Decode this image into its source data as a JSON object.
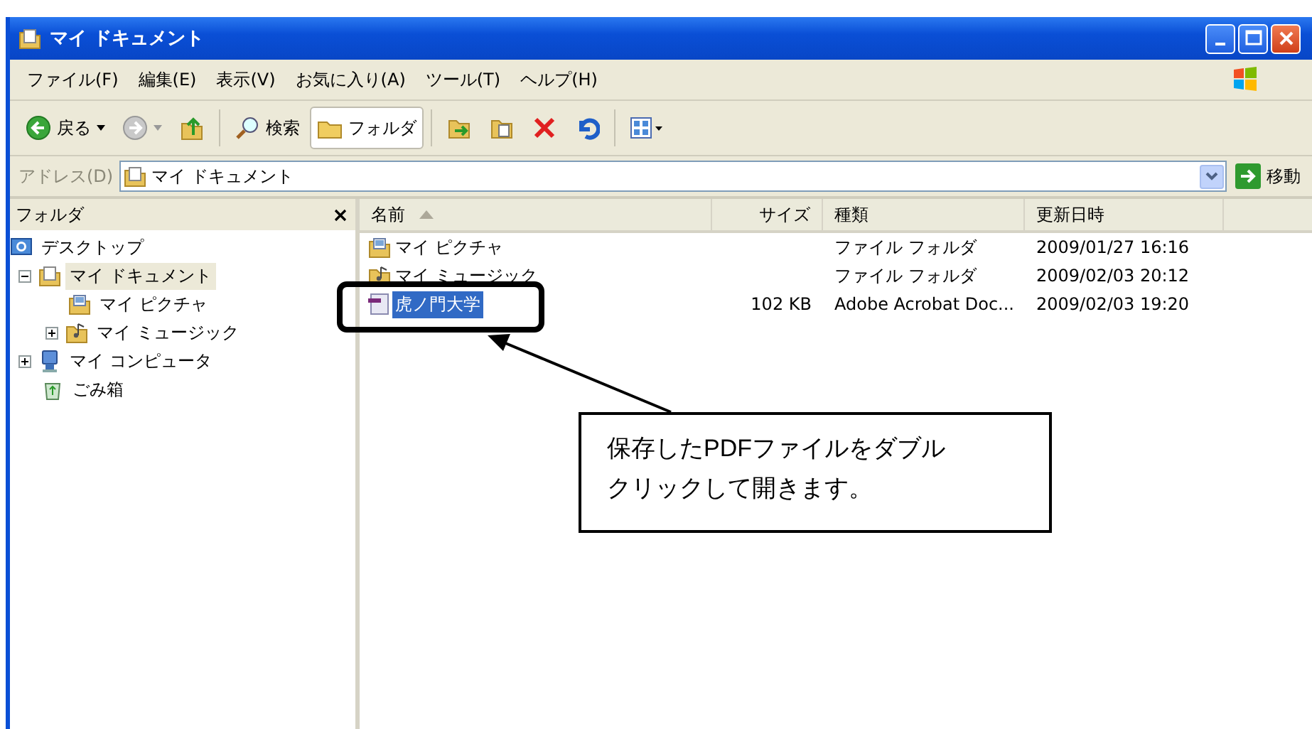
{
  "window": {
    "title": "マイ ドキュメント"
  },
  "menu": [
    "ファイル(F)",
    "編集(E)",
    "表示(V)",
    "お気に入り(A)",
    "ツール(T)",
    "ヘルプ(H)"
  ],
  "toolbar": [
    {
      "kind": "back",
      "label": "戻る",
      "selected": false
    },
    {
      "kind": "forward",
      "selected": false
    },
    {
      "kind": "up",
      "selected": false
    },
    {
      "kind": "search",
      "label": "検索",
      "selected": false
    },
    {
      "kind": "folders",
      "label": "フォルダ",
      "selected": true
    },
    {
      "kind": "move",
      "selected": false
    },
    {
      "kind": "copy",
      "selected": false
    },
    {
      "kind": "delete",
      "selected": false
    },
    {
      "kind": "undo",
      "selected": false
    },
    {
      "kind": "views",
      "selected": false
    }
  ],
  "address": {
    "label": "アドレス(D)",
    "value": "マイ ドキュメント",
    "go": "移動"
  },
  "folder_pane": {
    "title": "フォルダ",
    "tree": [
      {
        "label": "デスクトップ",
        "kind": "desktop",
        "selected": false,
        "children": [
          {
            "label": "マイ ドキュメント",
            "kind": "documents",
            "expanded": true,
            "selected": true,
            "children": [
              {
                "label": "マイ ピクチャ",
                "kind": "pictures",
                "selected": false
              },
              {
                "label": "マイ ミュージック",
                "kind": "music",
                "expanded": false,
                "selected": false
              }
            ]
          },
          {
            "label": "マイ コンピュータ",
            "kind": "computer",
            "expanded": false,
            "selected": false
          },
          {
            "label": "ごみ箱",
            "kind": "recycle",
            "selected": false
          }
        ]
      }
    ]
  },
  "file_list": {
    "columns": [
      "名前",
      "サイズ",
      "種類",
      "更新日時"
    ],
    "rows": [
      {
        "name": "マイ ピクチャ",
        "kind": "pictures",
        "size": "",
        "type": "ファイル フォルダ",
        "modified": "2009/01/27 16:16",
        "selected": false
      },
      {
        "name": "マイ ミュージック",
        "kind": "music",
        "size": "",
        "type": "ファイル フォルダ",
        "modified": "2009/02/03 20:12",
        "selected": false
      },
      {
        "name": "虎ノ門大学",
        "kind": "pdf",
        "size": "102 KB",
        "type": "Adobe Acrobat Doc...",
        "modified": "2009/02/03 19:20",
        "selected": true
      }
    ]
  },
  "callout": {
    "text": "保存したPDFファイルをダブルクリックして開きます。"
  }
}
